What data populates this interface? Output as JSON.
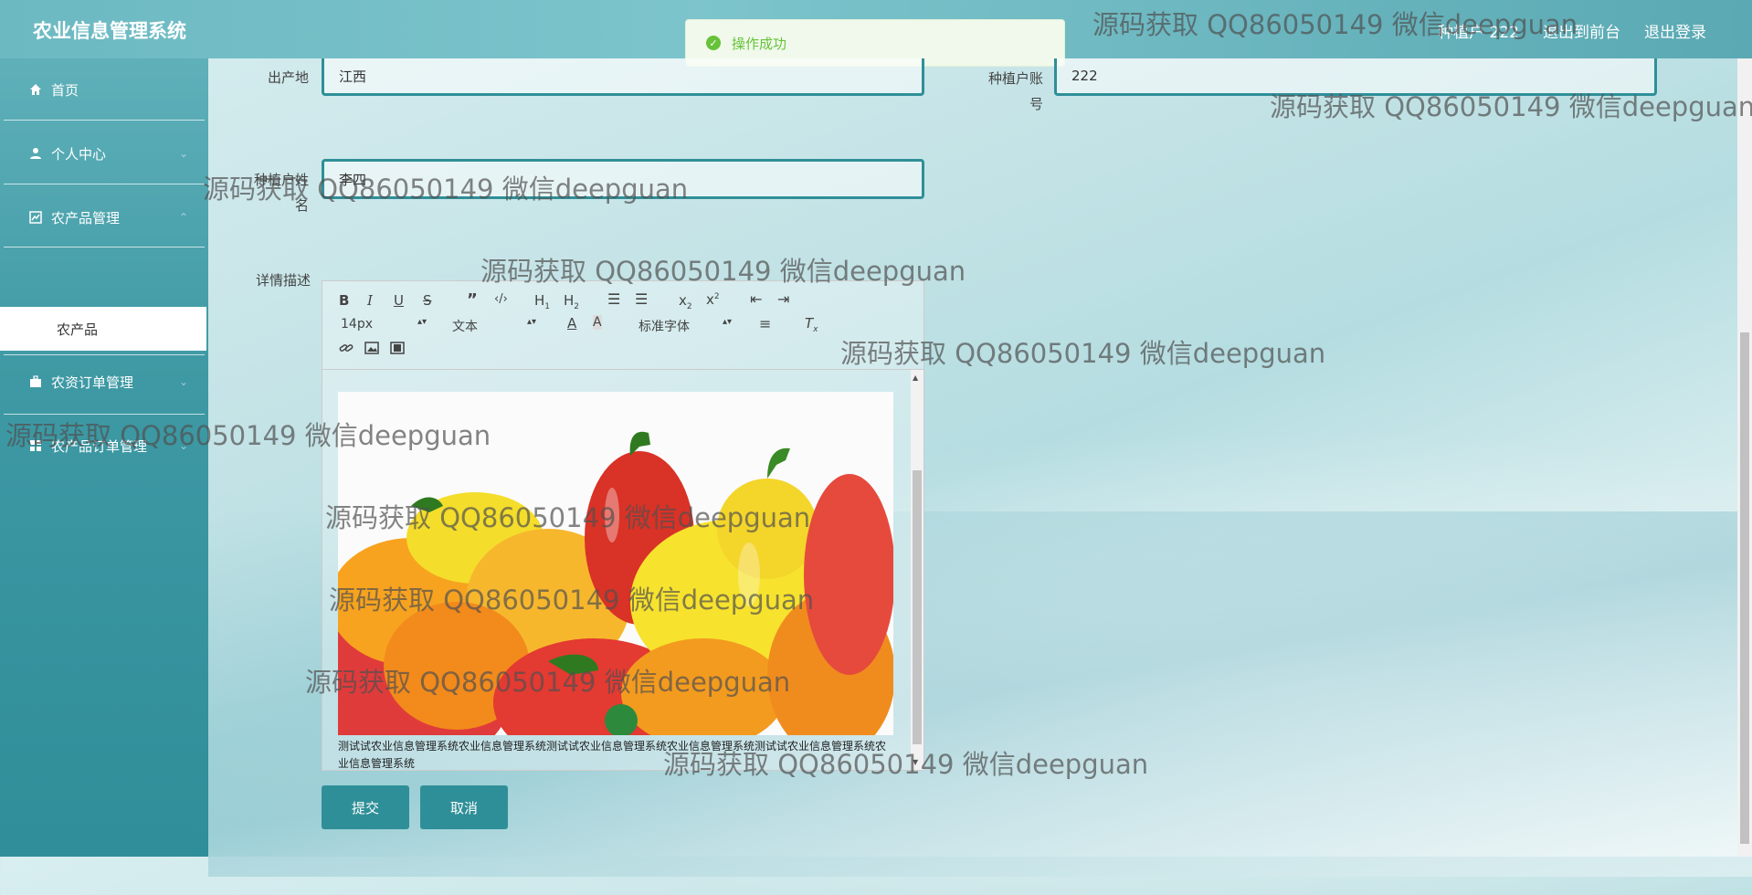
{
  "header": {
    "title": "农业信息管理系统",
    "user_label": "种植户 222",
    "front_link": "退出到前台",
    "logout_link": "退出登录"
  },
  "toast": {
    "message": "操作成功"
  },
  "sidebar": {
    "items": [
      {
        "label": "首页",
        "icon": "home-icon"
      },
      {
        "label": "个人中心",
        "icon": "user-icon"
      },
      {
        "label": "农产品管理",
        "icon": "chart-icon"
      },
      {
        "label": "农资订单管理",
        "icon": "briefcase-icon"
      },
      {
        "label": "农产品订单管理",
        "icon": "grid-icon"
      }
    ],
    "submenu": {
      "label": "农产品"
    }
  },
  "form": {
    "origin_label": "出产地",
    "origin_value": "江西",
    "account_label": "种植户账号",
    "account_value": "222",
    "planter_name_label": "种植户姓名",
    "planter_name_value": "李四",
    "description_label": "详情描述",
    "editor": {
      "font_size": "14px",
      "text_type": "文本",
      "font_family": "标准字体",
      "content_text": "测试试农业信息管理系统农业信息管理系统测试试农业信息管理系统农业信息管理系统测试试农业信息管理系统农业信息管理系统"
    },
    "submit_label": "提交",
    "cancel_label": "取消"
  },
  "watermark_text": "源码获取 QQ86050149 微信deepguan",
  "colors": {
    "accent": "#2f8f98",
    "success": "#67c23a"
  }
}
